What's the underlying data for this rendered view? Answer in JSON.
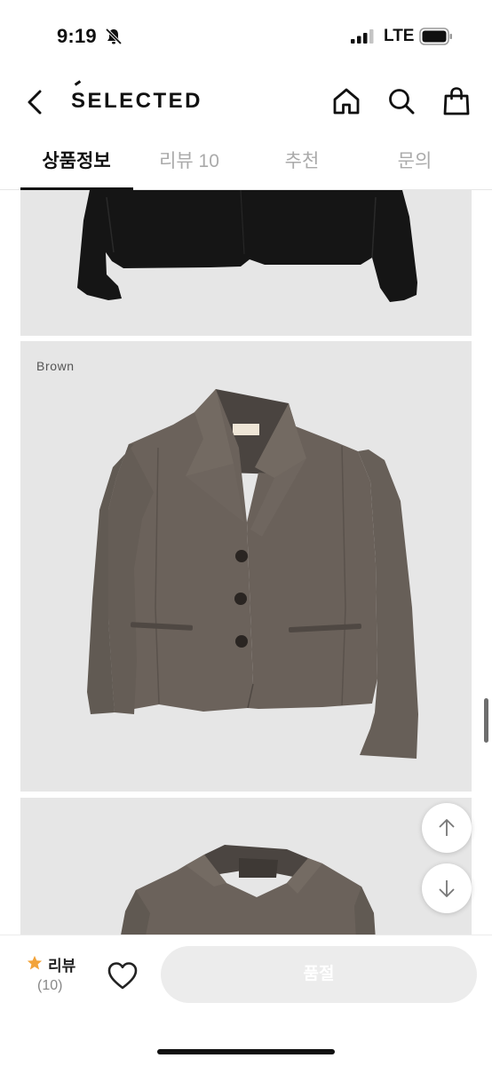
{
  "status_bar": {
    "time": "9:19",
    "network": "LTE",
    "icons": [
      "bell-slash-icon",
      "signal-icon",
      "battery-icon"
    ]
  },
  "header": {
    "brand": "SELECTED",
    "icons": [
      "chevron-left-icon",
      "home-icon",
      "search-icon",
      "shopping-bag-icon"
    ]
  },
  "tabs": [
    {
      "label": "상품정보",
      "active": true
    },
    {
      "label": "리뷰 10",
      "active": false
    },
    {
      "label": "추천",
      "active": false
    },
    {
      "label": "문의",
      "active": false
    }
  ],
  "product_images": [
    {
      "label": "",
      "color": "#141414"
    },
    {
      "label": "Brown",
      "color": "#6a615a"
    },
    {
      "label": "",
      "color": "#6a615a"
    }
  ],
  "floating_buttons": {
    "icons": [
      "arrow-up-icon",
      "arrow-down-icon"
    ]
  },
  "bottom_bar": {
    "review_label": "리뷰",
    "review_count": "(10)",
    "buy_button_label": "품절",
    "icons": [
      "star-icon",
      "heart-icon"
    ]
  },
  "colors": {
    "panel_background": "#e6e6e6",
    "star": "#f2a33a",
    "disabled_button": "#ececec",
    "tab_inactive": "#aaaaaa"
  }
}
